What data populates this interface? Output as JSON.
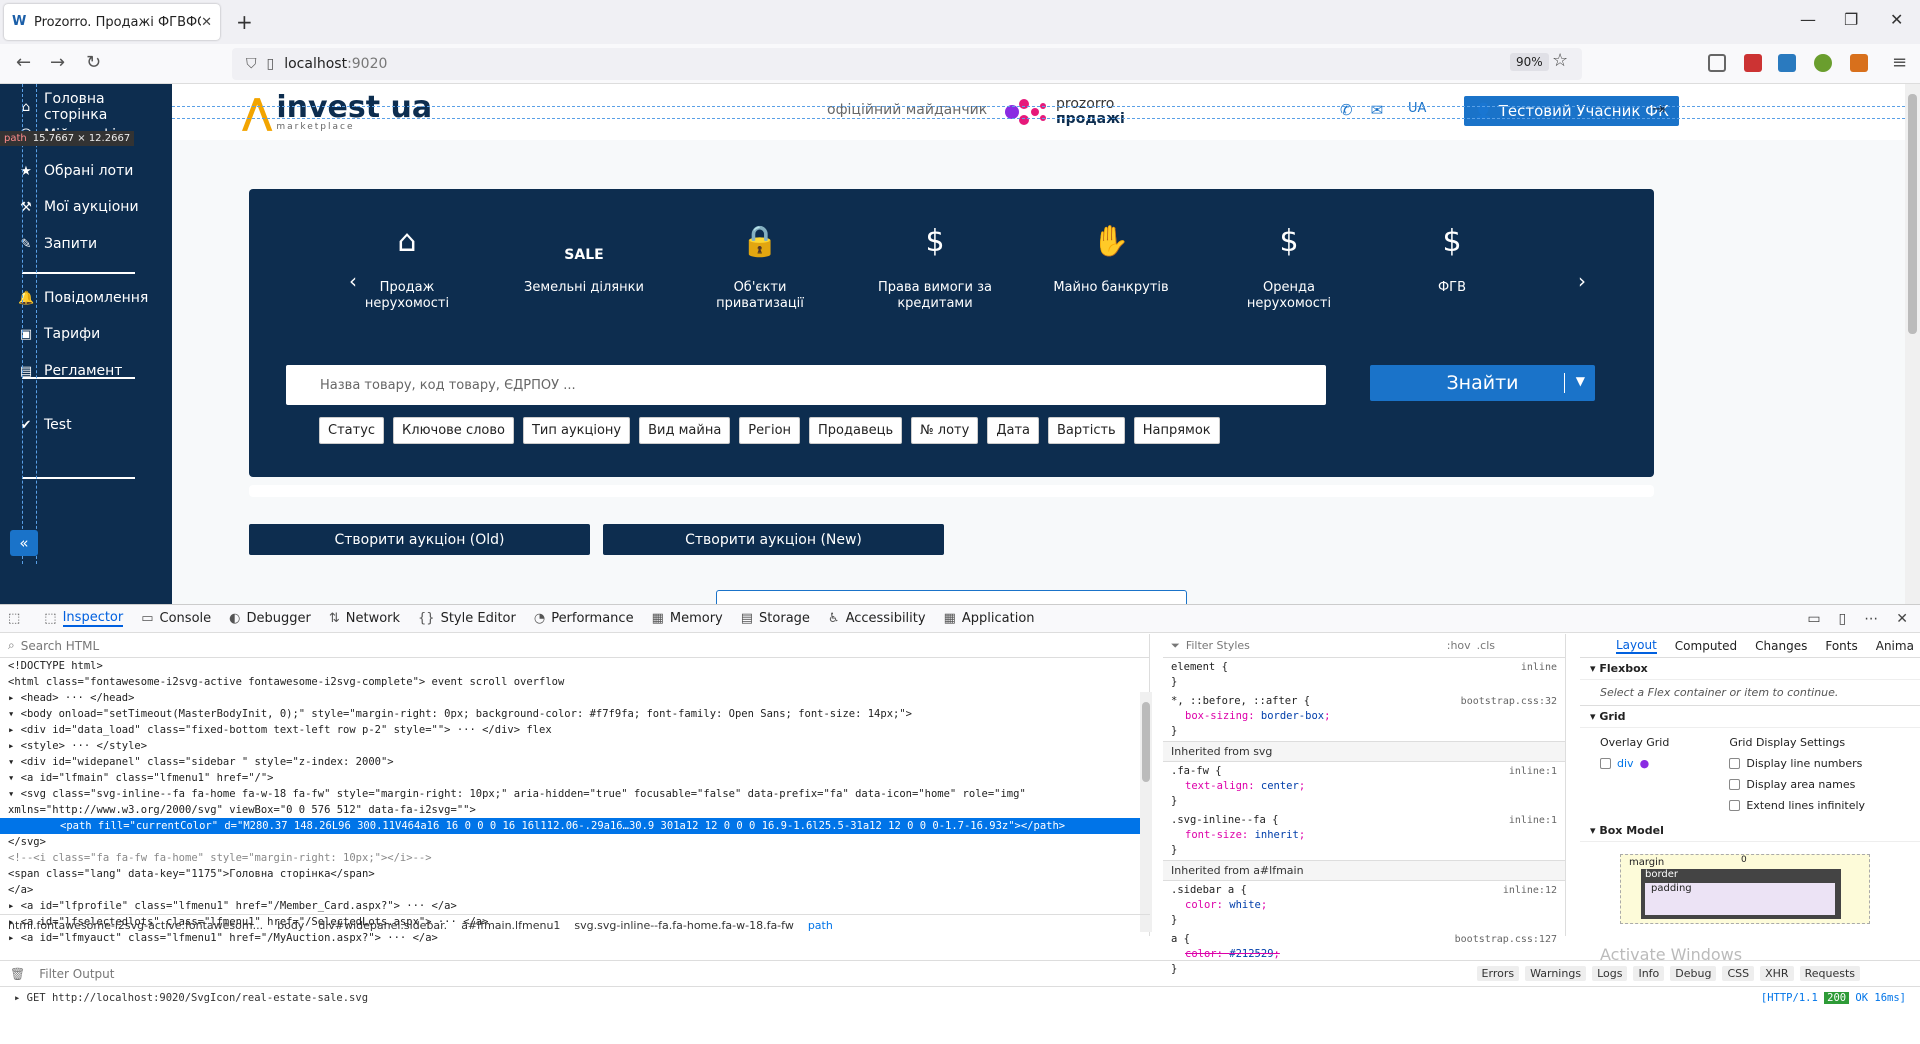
{
  "browser": {
    "tab_title": "Prozorro. Продажі ФГВФО. Про",
    "tab_icon_letter": "W",
    "url_host": "localhost",
    "url_port": ":9020",
    "zoom": "90%"
  },
  "sidebar": {
    "tooltip_tag": "path",
    "tooltip_size": "15.7667 × 12.2667",
    "items": [
      {
        "label": "Головна сторінка",
        "icon": "home-icon"
      },
      {
        "label": "Мій профіль",
        "icon": "user-icon"
      },
      {
        "label": "Обрані лоти",
        "icon": "star-icon"
      },
      {
        "label": "Мої аукціони",
        "icon": "gavel-icon"
      },
      {
        "label": "Запити",
        "icon": "pencil-icon"
      },
      {
        "label": "Повідомлення",
        "icon": "bell-icon"
      },
      {
        "label": "Тарифи",
        "icon": "money-icon"
      },
      {
        "label": "Регламент",
        "icon": "book-icon"
      },
      {
        "label": "Test",
        "icon": "check-circle-icon"
      }
    ],
    "collapse_glyph": "«"
  },
  "header": {
    "logo_text": "invest ua",
    "logo_sub": "marketplace",
    "official": "офіційний майданчик",
    "prozorro_1": "prozorro",
    "prozorro_2": "продажі",
    "lang": "UA",
    "user_button": "Тестовий Учасник ФК"
  },
  "hero": {
    "categories": [
      {
        "label": "Продаж нерухомості",
        "icon": "house-check-icon",
        "glyph": "⌂"
      },
      {
        "label": "Земельні ділянки",
        "icon": "sale-sign-icon",
        "glyph": "SALE"
      },
      {
        "label": "Об'єкти приватизації",
        "icon": "lock-icon",
        "glyph": "🔒"
      },
      {
        "label": "Права вимоги за кредитами",
        "icon": "document-search-icon",
        "glyph": "$"
      },
      {
        "label": "Майно банкрутів",
        "icon": "hands-icon",
        "glyph": "✋"
      },
      {
        "label": "Оренда нерухомості",
        "icon": "house-dollar-icon",
        "glyph": "$"
      },
      {
        "label": "ФГВ",
        "icon": "money-bag-icon",
        "glyph": "$"
      }
    ],
    "search_placeholder": "Назва товару, код товару, ЄДРПОУ ...",
    "find_button": "Знайти",
    "filters": [
      "Статус",
      "Ключове слово",
      "Тип аукціону",
      "Вид майна",
      "Регіон",
      "Продавець",
      "№ лоту",
      "Дата",
      "Вартість",
      "Напрямок"
    ]
  },
  "actions": {
    "create_old": "Створити аукціон (Old)",
    "create_new": "Створити аукціон (New)"
  },
  "devtools": {
    "tabs": [
      "Inspector",
      "Console",
      "Debugger",
      "Network",
      "Style Editor",
      "Performance",
      "Memory",
      "Storage",
      "Accessibility",
      "Application"
    ],
    "search_html": "Search HTML",
    "filter_styles": "Filter Styles",
    "hov": ":hov",
    "cls": ".cls",
    "tree_lines": [
      "<!DOCTYPE html>",
      "<html class=\"fontawesome-i2svg-active fontawesome-i2svg-complete\"> event scroll overflow",
      "▸ <head> ··· </head>",
      "▾ <body onload=\"setTimeout(MasterBodyInit, 0);\" style=\"margin-right: 0px; background-color: #f7f9fa; font-family: Open Sans; font-size: 14px;\">",
      "  ▸ <div id=\"data_load\" class=\"fixed-bottom text-left row p-2\" style=\"\"> ··· </div> flex",
      "  ▸ <style> ··· </style>",
      "  ▾ <div id=\"widepanel\" class=\"sidebar \" style=\"z-index: 2000\">",
      "    ▾ <a id=\"lfmain\" class=\"lfmenu1\" href=\"/\">",
      "      ▾ <svg class=\"svg-inline--fa fa-home fa-w-18 fa-fw\" style=\"margin-right: 10px;\" aria-hidden=\"true\" focusable=\"false\" data-prefix=\"fa\" data-icon=\"home\" role=\"img\"",
      "        xmlns=\"http://www.w3.org/2000/svg\" viewBox=\"0 0 576 512\" data-fa-i2svg=\"\">"
    ],
    "tree_selected": "<path fill=\"currentColor\" d=\"M280.37 148.26L96 300.11V464a16 16 0 0 0 16 16l112.06-.29a16…30.9 301a12 12 0 0 0 16.9-1.6l25.5-31a12 12 0 0 0-1.7-16.93z\"></path>",
    "tree_after": [
      "      </svg>",
      "      <!--<i class=\"fa fa-fw fa-home\" style=\"margin-right: 10px;\"></i>-->",
      "      <span class=\"lang\" data-key=\"1175\">Головна сторінка</span>",
      "    </a>",
      "    ▸ <a id=\"lfprofile\" class=\"lfmenu1\" href=\"/Member_Card.aspx?\"> ··· </a>",
      "    ▸ <a id=\"lfselectedlots\" class=\"lfmenu1\" href=\"/SelectedLots.aspx\"> ··· </a>",
      "    ▸ <a id=\"lfmyauct\" class=\"lfmenu1\" href=\"/MyAuction.aspx?\"> ··· </a>"
    ],
    "breadcrumb": [
      "html.fontawesome-i2svg-active.fontawesom...",
      "body",
      "div#widepanel.sidebar.",
      "a#lfmain.lfmenu1",
      "svg.svg-inline--fa.fa-home.fa-w-18.fa-fw",
      "path"
    ],
    "rules": [
      {
        "sel": "element {",
        "src": "inline",
        "props": []
      },
      {
        "sel": "*, ::before, ::after {",
        "src": "bootstrap.css:32",
        "props": [
          [
            "box-sizing",
            "border-box"
          ]
        ]
      }
    ],
    "inherited_svg": "Inherited from svg",
    "rules_svg": [
      {
        "sel": ".fa-fw {",
        "src": "inline:1",
        "props": [
          [
            "text-align",
            "center"
          ]
        ]
      },
      {
        "sel": ".svg-inline--fa {",
        "src": "inline:1",
        "props": [
          [
            "font-size",
            "inherit"
          ]
        ]
      }
    ],
    "inherited_a": "Inherited from a#lfmain",
    "rules_a": [
      {
        "sel": ".sidebar a {",
        "src": "inline:12",
        "props": [
          [
            "color",
            "white"
          ]
        ]
      },
      {
        "sel": "a {",
        "src": "bootstrap.css:127",
        "props": [
          [
            "color",
            "#212529"
          ]
        ]
      }
    ],
    "layout_tabs": [
      "Layout",
      "Computed",
      "Changes",
      "Fonts",
      "Anima"
    ],
    "flexbox": "Flexbox",
    "flex_msg": "Select a Flex container or item to continue.",
    "grid": "Grid",
    "overlay_grid": "Overlay Grid",
    "grid_settings": "Grid Display Settings",
    "overlay_item": "div",
    "grid_opts": [
      "Display line numbers",
      "Display area names",
      "Extend lines infinitely"
    ],
    "box_model": "Box Model",
    "bm_margin": "margin",
    "bm_border": "border",
    "bm_padding": "padding",
    "bm_zero": "0",
    "watermark": "Activate Windows",
    "filter_output": "Filter Output",
    "console_filters": [
      "Errors",
      "Warnings",
      "Logs",
      "Info",
      "Debug",
      "CSS",
      "XHR",
      "Requests"
    ],
    "console_line": "GET http://localhost:9020/SvgIcon/real-estate-sale.svg",
    "console_proto": "[HTTP/1.1",
    "console_status": "200",
    "console_time": "OK 16ms]"
  }
}
